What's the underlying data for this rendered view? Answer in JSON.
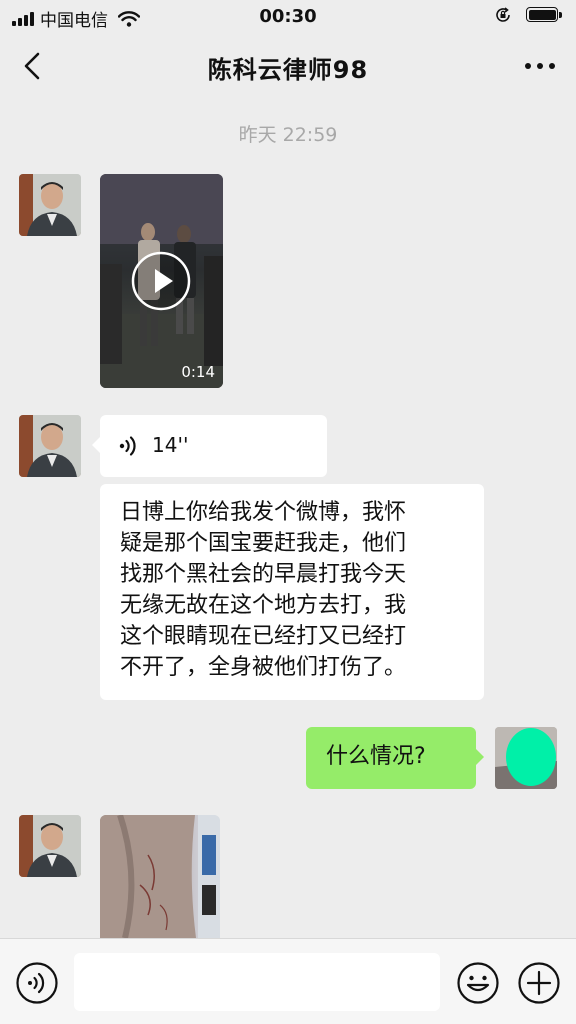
{
  "status_bar": {
    "carrier": "中国电信",
    "time": "00:30"
  },
  "header": {
    "title": "陈科云律师98"
  },
  "chat": {
    "timestamp": "昨天 22:59",
    "video": {
      "duration": "0:14"
    },
    "voice": {
      "duration": "14''"
    },
    "text_message": {
      "lines": [
        "日博上你给我发个微博，我怀",
        "疑是那个国宝要赶我走，他们",
        "找那个黑社会的早晨打我今天",
        "无缘无故在这个地方去打，我",
        "这个眼睛现在已经打又已经打",
        "不开了，全身被他们打伤了。"
      ]
    },
    "my_message": {
      "text": "什么情况?"
    }
  },
  "input_bar": {
    "value": ""
  },
  "icons": {
    "back": "chevron-left-icon",
    "more": "more-icon",
    "play": "play-icon",
    "voice": "voice-wave-icon",
    "keyboard_voice": "voice-toggle-icon",
    "emoji": "emoji-icon",
    "plus": "plus-icon"
  }
}
